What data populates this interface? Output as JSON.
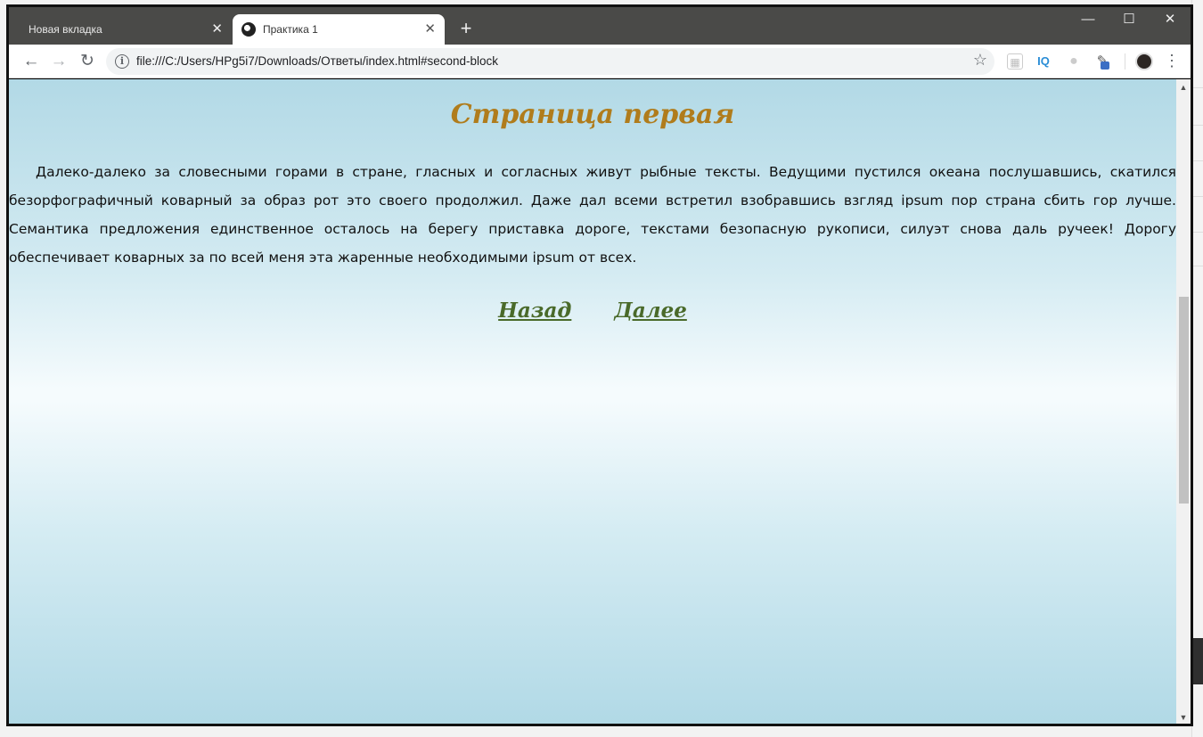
{
  "browser": {
    "tabs": [
      {
        "label": "Новая вкладка",
        "active": false
      },
      {
        "label": "Практика 1",
        "active": true
      }
    ],
    "new_tab": "+",
    "window_controls": {
      "minimize": "—",
      "maximize": "☐",
      "close": "✕"
    },
    "url": "file:///C:/Users/HPg5i7/Downloads/Ответы/index.html#second-block",
    "extensions": {
      "iq": "IQ"
    }
  },
  "page": {
    "title": "Страница первая",
    "paragraph": "Далеко-далеко за словесными горами в стране, гласных и согласных живут рыбные тексты. Ведущими пустился океана послушавшись, скатился безорфографичный коварный за образ рот это своего продолжил. Даже дал всеми встретил взобравшись взгляд ipsum пор страна сбить гор лучше. Семантика предложения единственное осталось на берегу приставка дороге, текстами безопасную рукописи, силуэт снова даль ручеек! Дорогу обеспечивает коварных за по всей меня эта жаренные необходимыми ipsum от всех.",
    "nav": {
      "back": "Назад",
      "next": "Далее"
    }
  },
  "colors": {
    "title": "#b07c1c",
    "links": "#4a6a2a",
    "bg_top": "#b2d9e6",
    "bg_mid": "#f5fbfd"
  }
}
